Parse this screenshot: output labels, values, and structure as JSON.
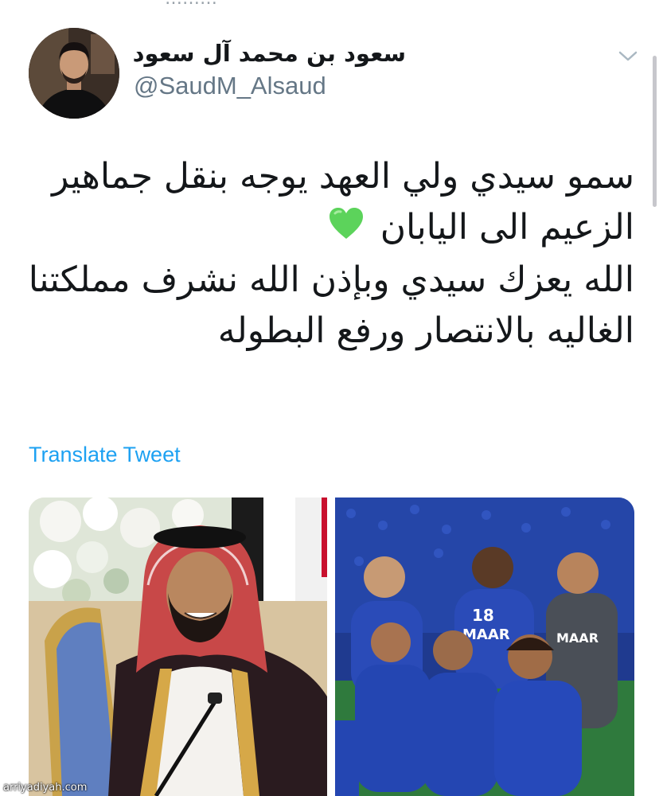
{
  "tweet": {
    "author": {
      "display_name": "سعود بن محمد آل سعود",
      "handle": "@SaudM_Alsaud"
    },
    "text_lines": [
      "سمو سيدي ولي العهد يوجه بنقل جماهير",
      "الزعيم الى اليابان",
      "الله يعزك سيدي وبإذن الله نشرف مملكتنا",
      "الغاليه بالانتصار ورفع البطوله"
    ],
    "emoji": "green-heart",
    "translate_label": "Translate Tweet",
    "media": [
      {
        "name": "photo-crown-prince"
      },
      {
        "name": "photo-al-hilal-team",
        "jersey_sponsor": "MAAR",
        "jersey_number": "18"
      }
    ]
  },
  "watermark": "arriyadiyah.com",
  "colors": {
    "link": "#1da1f2",
    "handle": "#657786",
    "text": "#14171a",
    "heart": "#5cd35b",
    "team_blue": "#2a4bb8"
  },
  "icons": {
    "menu": "chevron-down-icon",
    "heart": "green-heart-icon"
  }
}
